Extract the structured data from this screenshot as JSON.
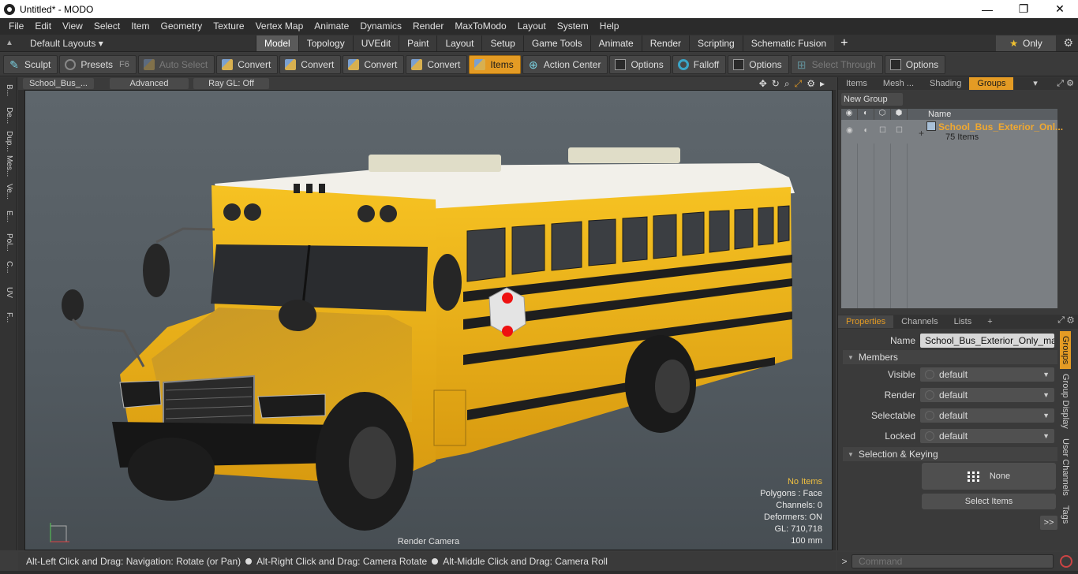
{
  "window": {
    "title": "Untitled* - MODO",
    "controls": [
      "—",
      "❐",
      "✕"
    ]
  },
  "menu": [
    "File",
    "Edit",
    "View",
    "Select",
    "Item",
    "Geometry",
    "Texture",
    "Vertex Map",
    "Animate",
    "Dynamics",
    "Render",
    "MaxToModo",
    "Layout",
    "System",
    "Help"
  ],
  "layout_bar": {
    "dropdown": "Default Layouts ▾",
    "tabs": [
      "Model",
      "Topology",
      "UVEdit",
      "Paint",
      "Layout",
      "Setup",
      "Game Tools",
      "Animate",
      "Render",
      "Scripting",
      "Schematic Fusion"
    ],
    "active_tab": "Model",
    "only_label": "Only"
  },
  "toolbar": {
    "sculpt": "Sculpt",
    "presets": "Presets",
    "presets_key": "F6",
    "auto_select": "Auto Select",
    "convert1": "Convert",
    "convert2": "Convert",
    "convert3": "Convert",
    "convert4": "Convert",
    "items": "Items",
    "action_center": "Action Center",
    "options1": "Options",
    "falloff": "Falloff",
    "options2": "Options",
    "select_through": "Select Through",
    "options3": "Options"
  },
  "left_tabs": [
    "B...",
    "De...",
    "Dup...",
    "Mes...",
    "Ve...",
    "E...",
    "Pol...",
    "C...",
    "UV",
    "F..."
  ],
  "viewport": {
    "scene_name": "School_Bus_...",
    "mode": "Advanced",
    "raygl": "Ray GL: Off",
    "camera": "Render Camera",
    "stats": {
      "selection": "No Items",
      "polygons": "Polygons : Face",
      "channels": "Channels: 0",
      "deformers": "Deformers: ON",
      "gl": "GL: 710,718",
      "scale": "100 mm"
    }
  },
  "status": {
    "hint1": "Alt-Left Click and Drag: Navigation: Rotate (or Pan)",
    "hint2": "Alt-Right Click and Drag: Camera Rotate",
    "hint3": "Alt-Middle Click and Drag: Camera Roll"
  },
  "groups_panel": {
    "tabs": [
      "Items",
      "Mesh ...",
      "Shading",
      "Groups"
    ],
    "active_tab": "Groups",
    "new_group": "New Group",
    "name_header": "Name",
    "group_name": "School_Bus_Exterior_Onl...",
    "group_count": "75 Items"
  },
  "properties_panel": {
    "tabs": [
      "Properties",
      "Channels",
      "Lists"
    ],
    "active_tab": "Properties",
    "name_label": "Name",
    "name_value": "School_Bus_Exterior_Only_max_",
    "members_section": "Members",
    "visible_label": "Visible",
    "visible_value": "default",
    "render_label": "Render",
    "render_value": "default",
    "selectable_label": "Selectable",
    "selectable_value": "default",
    "locked_label": "Locked",
    "locked_value": "default",
    "sel_section": "Selection & Keying",
    "none_btn": "None",
    "select_items_btn": "Select Items",
    "more_btn": ">>",
    "side_tabs": [
      "Groups",
      "Group Display",
      "User Channels",
      "Tags"
    ]
  },
  "command": {
    "placeholder": "Command",
    "arrow": ">"
  },
  "colors": {
    "accent": "#e49b24",
    "bus_yellow": "#f2b818",
    "viewport_bg": "#5a6268"
  }
}
